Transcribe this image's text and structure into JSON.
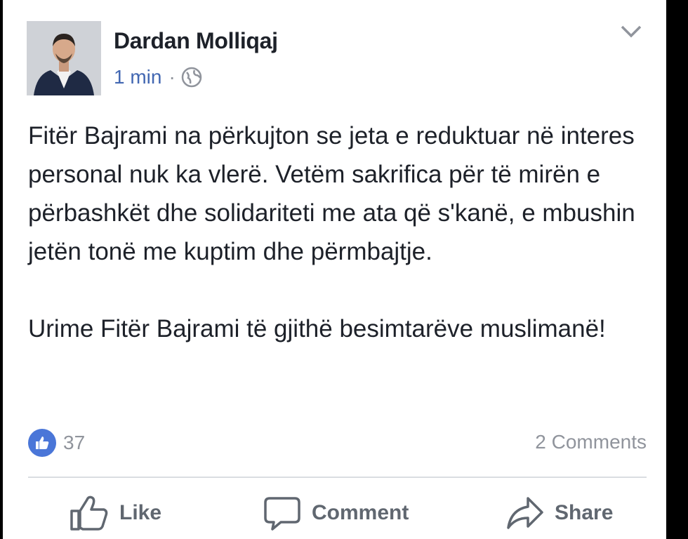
{
  "post": {
    "author": "Dardan Molliqaj",
    "time": "1 min",
    "separator": "·",
    "privacy_icon": "globe-icon",
    "menu_icon": "chevron-down-icon",
    "paragraphs": [
      "Fitër Bajrami na përkujton se jeta e reduktuar në interes personal nuk ka vlerë. Vetëm sakrifica për të mirën e përbashkët dhe solidariteti me ata që s'kanë, e mbushin jetën tonë me kuptim dhe përmbajtje.",
      "Urime Fitër Bajrami të gjithë besimtarëve muslimanë!"
    ],
    "reaction_count": "37",
    "comments_label": "2 Comments"
  },
  "actions": {
    "like": "Like",
    "comment": "Comment",
    "share": "Share"
  },
  "colors": {
    "link_blue": "#4267b2",
    "like_blue": "#4a76d8",
    "text": "#1d2129",
    "muted": "#90949c",
    "action_gray": "#606770"
  }
}
